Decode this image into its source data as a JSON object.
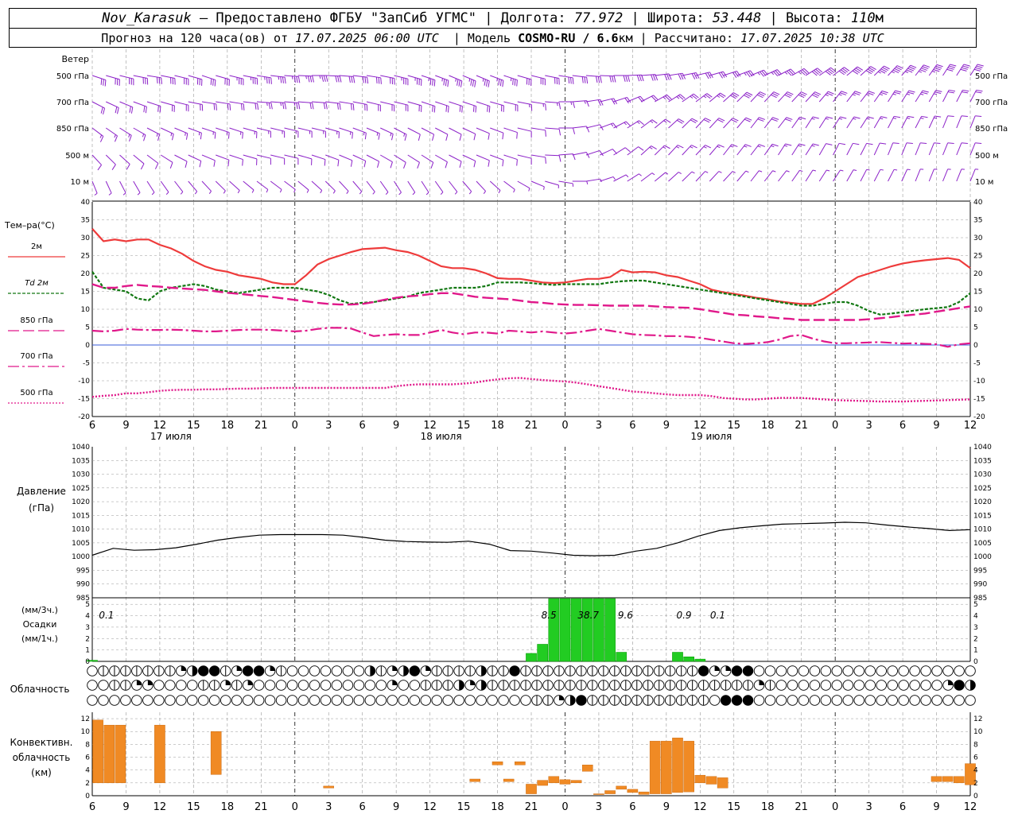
{
  "header": {
    "station": "Nov_Karasuk",
    "provider": "– Предоставлено ФГБУ \"ЗапСиб УГМС\"",
    "lon_label": "Долгота:",
    "lon_value": "77.972",
    "lat_label": "Широта:",
    "lat_value": "53.448",
    "alt_label": "Высота:",
    "alt_value": "110",
    "alt_unit": "м",
    "forecast_label": "Прогноз на 120 часа(ов) от",
    "forecast_time": "17.07.2025 06:00 UTC",
    "model_label": "Модель",
    "model_value": "COSMO-RU / 6.6",
    "model_unit": "км",
    "calc_label": "Рассчитано:",
    "calc_time": "17.07.2025 10:38 UTC"
  },
  "colors": {
    "wind": "#8b20c8",
    "t2m": "#ee3b3b",
    "td2m": "#117711",
    "t850": "#e0188a",
    "t700": "#e0188a",
    "t500": "#e0188a",
    "zero": "#3a5bd8",
    "pressure": "#000000",
    "precip": "#22cc22",
    "convective": "#f08a24",
    "grid": "#999999"
  },
  "wind_panel": {
    "title": "Ветер",
    "levels": [
      "500 гПа",
      "700 гПа",
      "850 гПа",
      "500 м",
      "10 м"
    ],
    "levels_right": [
      "500 гПа",
      "700 гПа",
      "850 гПа",
      "500 м",
      "10 м"
    ],
    "barbs": [
      {
        "level": "500 гПа",
        "dir": [
          250,
          255,
          260,
          255,
          250,
          255,
          260,
          265,
          270,
          265,
          260,
          255,
          250,
          245,
          245,
          250,
          255,
          260,
          265,
          270,
          275,
          280,
          285,
          290,
          295,
          300,
          305,
          310,
          315,
          320,
          325,
          330,
          330
        ],
        "speed": [
          30,
          30,
          30,
          32,
          34,
          35,
          36,
          36,
          35,
          34,
          34,
          35,
          36,
          36,
          35,
          35,
          34,
          34,
          32,
          30,
          30,
          30,
          32,
          34,
          36,
          38,
          40,
          42,
          44,
          46,
          46,
          44,
          42
        ]
      },
      {
        "level": "700 гПа",
        "dir": [
          240,
          245,
          250,
          255,
          260,
          260,
          265,
          265,
          265,
          260,
          255,
          255,
          250,
          250,
          250,
          255,
          260,
          270,
          280,
          290,
          300,
          305,
          310,
          315,
          320,
          320,
          320,
          325,
          325,
          330,
          330,
          335,
          335
        ],
        "speed": [
          20,
          20,
          22,
          22,
          24,
          24,
          25,
          25,
          24,
          24,
          22,
          22,
          22,
          20,
          20,
          20,
          18,
          18,
          20,
          22,
          24,
          26,
          28,
          30,
          30,
          30,
          30,
          28,
          28,
          26,
          26,
          24,
          24
        ]
      },
      {
        "level": "850 гПа",
        "dir": [
          230,
          235,
          240,
          245,
          250,
          250,
          255,
          255,
          255,
          250,
          245,
          240,
          240,
          240,
          245,
          250,
          260,
          270,
          285,
          300,
          310,
          315,
          320,
          320,
          325,
          325,
          330,
          330,
          330,
          335,
          335,
          340,
          340
        ],
        "speed": [
          15,
          15,
          16,
          16,
          18,
          18,
          18,
          16,
          16,
          15,
          15,
          15,
          14,
          14,
          14,
          14,
          12,
          12,
          14,
          16,
          18,
          20,
          20,
          20,
          20,
          20,
          18,
          18,
          16,
          16,
          16,
          14,
          14
        ]
      },
      {
        "level": "500 м",
        "dir": [
          220,
          225,
          230,
          240,
          245,
          250,
          255,
          255,
          250,
          245,
          240,
          235,
          235,
          240,
          245,
          250,
          260,
          275,
          290,
          305,
          315,
          320,
          320,
          325,
          325,
          330,
          330,
          335,
          335,
          340,
          340,
          340,
          340
        ],
        "speed": [
          10,
          10,
          12,
          12,
          14,
          14,
          12,
          12,
          12,
          12,
          12,
          12,
          10,
          10,
          10,
          10,
          10,
          10,
          12,
          14,
          15,
          16,
          16,
          16,
          16,
          15,
          15,
          14,
          14,
          14,
          12,
          12,
          12
        ]
      },
      {
        "level": "10 м",
        "dir": [
          200,
          205,
          210,
          215,
          220,
          225,
          230,
          230,
          225,
          220,
          215,
          210,
          210,
          215,
          220,
          230,
          245,
          260,
          280,
          300,
          310,
          315,
          320,
          320,
          325,
          325,
          330,
          330,
          335,
          335,
          340,
          340,
          340
        ],
        "speed": [
          6,
          6,
          6,
          7,
          7,
          8,
          8,
          8,
          7,
          7,
          6,
          6,
          6,
          6,
          5,
          5,
          5,
          5,
          6,
          7,
          8,
          8,
          8,
          8,
          8,
          7,
          7,
          7,
          6,
          6,
          6,
          6,
          6
        ]
      }
    ]
  },
  "temp_panel": {
    "title": "Тем–ра(°С)",
    "legend": [
      {
        "name": "2м",
        "style": "solid"
      },
      {
        "name": "2м",
        "prefix": "Td",
        "style": "dashed"
      },
      {
        "name": "850 гПа",
        "style": "longdash"
      },
      {
        "name": "700 гПа",
        "style": "dashdot"
      },
      {
        "name": "500 гПа",
        "style": "dotted"
      }
    ],
    "yticks": [
      "40",
      "35",
      "30",
      "25",
      "20",
      "15",
      "10",
      "5",
      "0",
      "-5",
      "-10",
      "-15",
      "-20"
    ]
  },
  "x_axis": {
    "ticks": [
      "6",
      "9",
      "12",
      "15",
      "18",
      "21",
      "0",
      "3",
      "6",
      "9",
      "12",
      "15",
      "18",
      "21",
      "0",
      "3",
      "6",
      "9",
      "12",
      "15",
      "18",
      "21",
      "0",
      "3",
      "6",
      "9",
      "12"
    ],
    "days": [
      "17 июля",
      "18 июля",
      "19 июля"
    ]
  },
  "pressure_panel": {
    "title1": "Давление",
    "title2": "(гПа)",
    "yticks": [
      "1040",
      "1035",
      "1030",
      "1025",
      "1020",
      "1015",
      "1010",
      "1005",
      "1000",
      "995",
      "990",
      "985"
    ]
  },
  "precip_panel": {
    "title1": "(мм/3ч.)",
    "title2": "Осадки",
    "title3": "(мм/1ч.)",
    "yticks": [
      "5",
      "4",
      "3",
      "2",
      "1",
      "0"
    ],
    "labels": [
      {
        "hour": 0.7,
        "text": "0.1"
      },
      {
        "hour": 40,
        "text": "8.5"
      },
      {
        "hour": 43.5,
        "text": "38.7"
      },
      {
        "hour": 46.8,
        "text": "9.6"
      },
      {
        "hour": 52,
        "text": "0.9"
      },
      {
        "hour": 55,
        "text": "0.1"
      }
    ]
  },
  "cloud_panel": {
    "title": "Облачность"
  },
  "conv_panel": {
    "title1": "Конвективн.",
    "title2": "облачность",
    "title3": "(км)",
    "yticks": [
      "12",
      "10",
      "8",
      "6",
      "4",
      "2",
      "0"
    ]
  },
  "chart_data": [
    {
      "type": "line",
      "title": "Тем–ра(°С)",
      "ylim": [
        -20,
        40
      ],
      "x_hours_from_start": [
        0,
        1,
        2,
        3,
        4,
        5,
        6,
        7,
        8,
        9,
        10,
        11,
        12,
        13,
        14,
        15,
        16,
        17,
        18,
        19,
        20,
        21,
        22,
        23,
        24,
        25,
        26,
        27,
        28,
        29,
        30,
        31,
        32,
        33,
        34,
        35,
        36,
        37,
        38,
        39,
        40,
        41,
        42,
        43,
        44,
        45,
        46,
        47,
        48,
        49,
        50,
        51,
        52,
        53,
        54,
        55,
        56,
        57,
        58,
        59,
        60,
        61,
        62,
        63,
        64,
        65,
        66,
        67,
        68,
        69,
        70,
        71,
        72,
        73,
        74,
        75,
        76,
        77,
        78
      ],
      "series": [
        {
          "name": "2м",
          "values": [
            32.5,
            29,
            29.5,
            29,
            29.5,
            29.5,
            28,
            27,
            25.5,
            23.5,
            22,
            21,
            20.5,
            19.5,
            19,
            18.5,
            17.5,
            17,
            17,
            19.5,
            22.5,
            24,
            25,
            26,
            26.8,
            27,
            27.2,
            26.5,
            26,
            25,
            23.5,
            22,
            21.5,
            21.5,
            21,
            20,
            18.7,
            18.5,
            18.5,
            18,
            17.5,
            17.3,
            17.5,
            18,
            18.5,
            18.5,
            19,
            21,
            20.3,
            20.5,
            20.3,
            19.5,
            19,
            18,
            17,
            15.5,
            14.8,
            14.3,
            13.8,
            13.2,
            12.8,
            12.2,
            11.8,
            11.5,
            11.5,
            13,
            15,
            17,
            19,
            20,
            21,
            22,
            22.8,
            23.3,
            23.7,
            24,
            24.3,
            23.8,
            21.5
          ]
        },
        {
          "name": "Td 2м",
          "values": [
            20.5,
            16,
            15.5,
            15,
            13,
            12.5,
            15,
            16,
            16.5,
            17,
            16.5,
            15.5,
            15,
            14.5,
            15,
            15.5,
            16,
            16,
            16,
            15.5,
            15,
            14,
            12.5,
            11.5,
            11.8,
            12,
            12.5,
            13,
            13.5,
            14.5,
            15,
            15.5,
            16,
            16,
            16,
            16.5,
            17.5,
            17.5,
            17.5,
            17.3,
            17,
            16.8,
            17,
            17,
            17,
            17,
            17.5,
            17.8,
            18,
            18,
            17.5,
            17,
            16.5,
            16,
            15.5,
            15,
            14.5,
            14,
            13.5,
            13,
            12.5,
            12,
            11.5,
            11,
            11,
            11.5,
            12,
            12,
            11,
            9.5,
            8.5,
            8.8,
            9.2,
            9.6,
            10,
            10.3,
            10.6,
            12,
            14.5
          ]
        },
        {
          "name": "850 гПа",
          "values": [
            17,
            16,
            16,
            16.5,
            16.8,
            16.5,
            16.3,
            16,
            15.8,
            15.6,
            15.4,
            15,
            14.6,
            14.3,
            14,
            13.7,
            13.4,
            13,
            12.6,
            12.2,
            11.8,
            11.5,
            11.3,
            11.3,
            11.5,
            12,
            12.7,
            13.2,
            13.6,
            13.8,
            14.2,
            14.5,
            14.5,
            14,
            13.5,
            13.2,
            13,
            12.8,
            12.4,
            12,
            11.8,
            11.5,
            11.3,
            11.2,
            11.2,
            11.1,
            11,
            11,
            11,
            11,
            10.8,
            10.6,
            10.5,
            10.4,
            10,
            9.5,
            9,
            8.5,
            8.3,
            8,
            7.8,
            7.5,
            7.3,
            7,
            7,
            7,
            7,
            7,
            7,
            7.2,
            7.5,
            7.8,
            8.2,
            8.5,
            8.8,
            9.3,
            9.8,
            10.3,
            10.8
          ]
        },
        {
          "name": "700 гПа",
          "values": [
            4,
            3.8,
            4,
            4.5,
            4.3,
            4.2,
            4.2,
            4.3,
            4.2,
            4,
            3.8,
            3.8,
            4,
            4.2,
            4.3,
            4.3,
            4.2,
            4,
            3.8,
            4,
            4.5,
            4.8,
            4.8,
            4.6,
            3.5,
            2.5,
            2.8,
            3,
            2.8,
            2.8,
            3.5,
            4.2,
            3.5,
            3,
            3.5,
            3.5,
            3.2,
            4,
            3.8,
            3.5,
            3.8,
            3.5,
            3.2,
            3.5,
            4,
            4.5,
            4,
            3.5,
            3,
            2.8,
            2.7,
            2.5,
            2.5,
            2.3,
            2,
            1.5,
            1,
            0.5,
            0.3,
            0.5,
            0.8,
            1.5,
            2.5,
            2.8,
            1.8,
            1,
            0.5,
            0.5,
            0.6,
            0.7,
            0.8,
            0.6,
            0.4,
            0.5,
            0.3,
            0.2,
            -0.5,
            0.2,
            0.5
          ]
        },
        {
          "name": "500 гПа",
          "values": [
            -14.5,
            -14.2,
            -14,
            -13.5,
            -13.5,
            -13.2,
            -12.8,
            -12.6,
            -12.5,
            -12.5,
            -12.4,
            -12.4,
            -12.3,
            -12.2,
            -12.2,
            -12.1,
            -12,
            -12,
            -12,
            -12,
            -12,
            -12,
            -12,
            -12,
            -12,
            -12,
            -12,
            -11.5,
            -11.2,
            -11,
            -11,
            -11,
            -11,
            -10.8,
            -10.5,
            -10,
            -9.6,
            -9.3,
            -9.2,
            -9.5,
            -9.8,
            -10,
            -10.2,
            -10.5,
            -11,
            -11.5,
            -12,
            -12.5,
            -13,
            -13.2,
            -13.5,
            -13.8,
            -14,
            -14,
            -14,
            -14.3,
            -14.8,
            -15,
            -15.2,
            -15.2,
            -15,
            -14.8,
            -14.8,
            -14.8,
            -15,
            -15.2,
            -15.4,
            -15.5,
            -15.6,
            -15.7,
            -15.8,
            -15.8,
            -15.8,
            -15.7,
            -15.6,
            -15.5,
            -15.4,
            -15.3,
            -15.2
          ]
        }
      ]
    },
    {
      "type": "line",
      "title": "Давление",
      "ylabel": "(гПа)",
      "ylim": [
        985,
        1040
      ],
      "x_hours_from_start": [
        0,
        3,
        6,
        9,
        12,
        15,
        18,
        21,
        24,
        27,
        30,
        33,
        36,
        37,
        38,
        39,
        42,
        45,
        48,
        51,
        54,
        57,
        60,
        63,
        66,
        69,
        72,
        75,
        78
      ],
      "values": [
        1000.5,
        1003,
        1002.3,
        1002.5,
        1003.2,
        1004.5,
        1006,
        1007,
        1007.8,
        1008,
        1008,
        1008,
        1007.8,
        1007,
        1006,
        1005.5,
        1005.3,
        1005.2,
        1005.6,
        1004.5,
        1002.2,
        1002,
        1001.3,
        1000.5,
        1000.3,
        1000.5,
        1002,
        1003,
        1005,
        1007.5,
        1009.5,
        1010.5,
        1011.2,
        1011.8,
        1012,
        1012.2,
        1012.5,
        1012.3,
        1011.5,
        1010.8,
        1010.2,
        1009.5,
        1009.8
      ]
    },
    {
      "type": "bar",
      "title": "Осадки",
      "ylabel": "(мм/1ч.)",
      "ylim": [
        0,
        5
      ],
      "x_hours_from_start": [
        0,
        39,
        40,
        41,
        42,
        43,
        44,
        45,
        46,
        47,
        52,
        53,
        54
      ],
      "values": [
        0.1,
        0.7,
        1.5,
        5.5,
        5.5,
        5.5,
        5.5,
        5.5,
        5.5,
        0.8,
        0.8,
        0.4,
        0.2
      ]
    },
    {
      "type": "bar",
      "title": "Конвективн. облачность",
      "ylabel": "(км)",
      "ylim": [
        0,
        12
      ],
      "x_hours_from_start": [
        0.5,
        1.5,
        2.5,
        6,
        11,
        21,
        34,
        36,
        37,
        38,
        39,
        40,
        41,
        42,
        43,
        44,
        45,
        46,
        47,
        48,
        49,
        50,
        51,
        52,
        53,
        54,
        55,
        56,
        75,
        76,
        77,
        78
      ],
      "base": [
        2,
        2,
        2,
        2,
        3.3,
        1.2,
        2.2,
        4.8,
        2.2,
        4.8,
        0.3,
        1.6,
        2,
        1.8,
        2,
        3.8,
        0.2,
        0.3,
        1,
        0.5,
        0.2,
        0.3,
        0.3,
        0.5,
        0.6,
        2,
        1.8,
        1.2,
        2.2,
        2.2,
        2,
        1.7
      ],
      "top": [
        11.8,
        11,
        11,
        11,
        10,
        1.5,
        2.6,
        5.3,
        2.6,
        5.3,
        1.8,
        2.4,
        3,
        2.5,
        2.4,
        4.8,
        0.3,
        0.8,
        1.5,
        1,
        0.6,
        8.5,
        8.5,
        9,
        8.5,
        3.2,
        3,
        2.8,
        3,
        3,
        3,
        5
      ]
    }
  ]
}
